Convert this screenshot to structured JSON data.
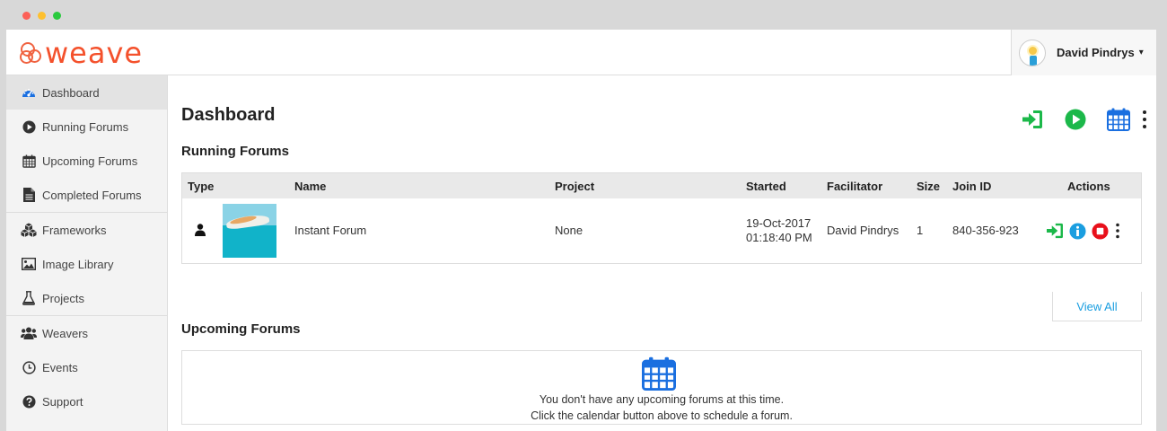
{
  "app": {
    "logo_text": "weave",
    "brand_color": "#f4512c",
    "user": {
      "name": "David Pindrys",
      "caret": "▾"
    }
  },
  "sidebar": {
    "items": [
      {
        "label": "Dashboard",
        "icon": "dashboard-gauge-icon",
        "active": true
      },
      {
        "label": "Running Forums",
        "icon": "play-circle-icon"
      },
      {
        "label": "Upcoming Forums",
        "icon": "calendar-icon"
      },
      {
        "label": "Completed Forums",
        "icon": "document-icon"
      },
      {
        "label": "Frameworks",
        "icon": "cubes-icon"
      },
      {
        "label": "Image Library",
        "icon": "image-icon"
      },
      {
        "label": "Projects",
        "icon": "flask-icon"
      },
      {
        "label": "Weavers",
        "icon": "users-icon"
      },
      {
        "label": "Events",
        "icon": "clock-icon"
      },
      {
        "label": "Support",
        "icon": "question-circle-icon"
      }
    ]
  },
  "main": {
    "title": "Dashboard",
    "top_actions": [
      "join-forum-icon",
      "start-forum-icon",
      "schedule-calendar-icon",
      "more-vertical-icon"
    ],
    "running": {
      "title": "Running Forums",
      "columns": [
        "Type",
        "Name",
        "Project",
        "Started",
        "Facilitator",
        "Size",
        "Join ID",
        "Actions"
      ],
      "rows": [
        {
          "type_icon": "person-icon",
          "name": "Instant Forum",
          "project": "None",
          "started_date": "19-Oct-2017",
          "started_time": "01:18:40 PM",
          "facilitator": "David Pindrys",
          "size": "1",
          "join_id": "840-356-923"
        }
      ],
      "view_all": "View All"
    },
    "upcoming": {
      "title": "Upcoming Forums",
      "empty_line1": "You don't have any upcoming forums at this time.",
      "empty_line2": "Click the calendar button above to schedule a forum."
    }
  },
  "colors": {
    "green": "#1cb84a",
    "blue": "#1a6fe0",
    "info": "#1a9ee0",
    "red": "#e8101b"
  }
}
